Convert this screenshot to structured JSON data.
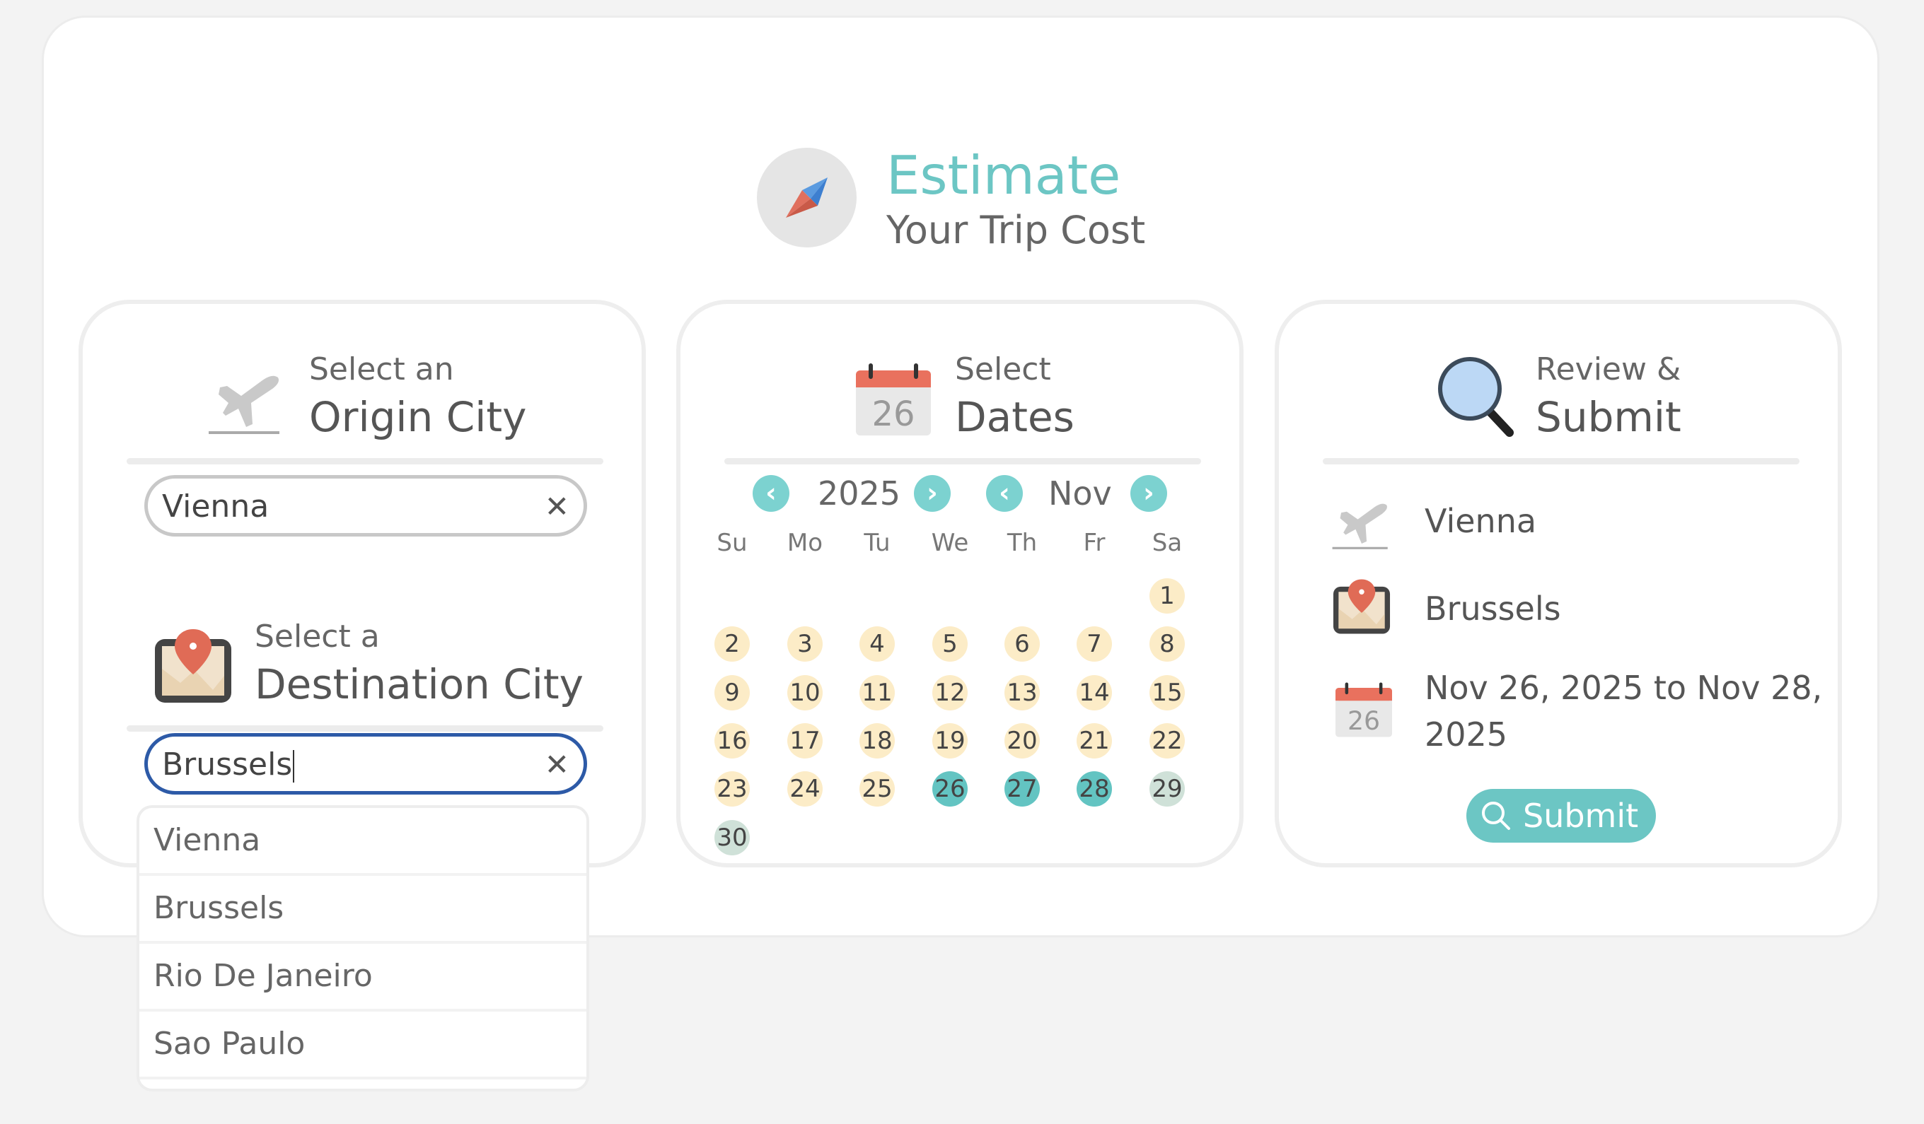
{
  "header": {
    "title": "Estimate",
    "subtitle": "Your Trip Cost",
    "logo_icon": "compass-icon"
  },
  "origin": {
    "small": "Select an",
    "big": "Origin City",
    "icon": "airplane-icon",
    "input_value": "Vienna",
    "clear_icon": "close-icon"
  },
  "destination": {
    "small": "Select a",
    "big": "Destination City",
    "icon": "map-pin-icon",
    "input_value": "Brussels",
    "clear_icon": "close-icon",
    "suggestions": [
      "Vienna",
      "Brussels",
      "Rio De Janeiro",
      "Sao Paulo"
    ]
  },
  "dates": {
    "small": "Select",
    "big": "Dates",
    "icon_day": "26",
    "year": "2025",
    "month": "Nov",
    "weekdays": [
      "Su",
      "Mo",
      "Tu",
      "We",
      "Th",
      "Fr",
      "Sa"
    ],
    "first_weekday_index": 6,
    "days_in_month": 30,
    "selected_days": [
      26,
      27,
      28
    ],
    "muted_days": [
      29,
      30
    ]
  },
  "review": {
    "small": "Review &",
    "big": "Submit",
    "icon": "magnifier-icon",
    "origin": "Vienna",
    "destination": "Brussels",
    "dates_line1": "Nov 26, 2025 to Nov 28,",
    "dates_line2": "2025",
    "calendar_icon_day": "26",
    "submit_label": "Submit"
  },
  "colors": {
    "accent": "#6cc6c4",
    "day_bg": "#fcecc7",
    "selected_day": "#63c4c2",
    "muted_day": "#cfe1d8",
    "active_border": "#2d5aa7"
  }
}
